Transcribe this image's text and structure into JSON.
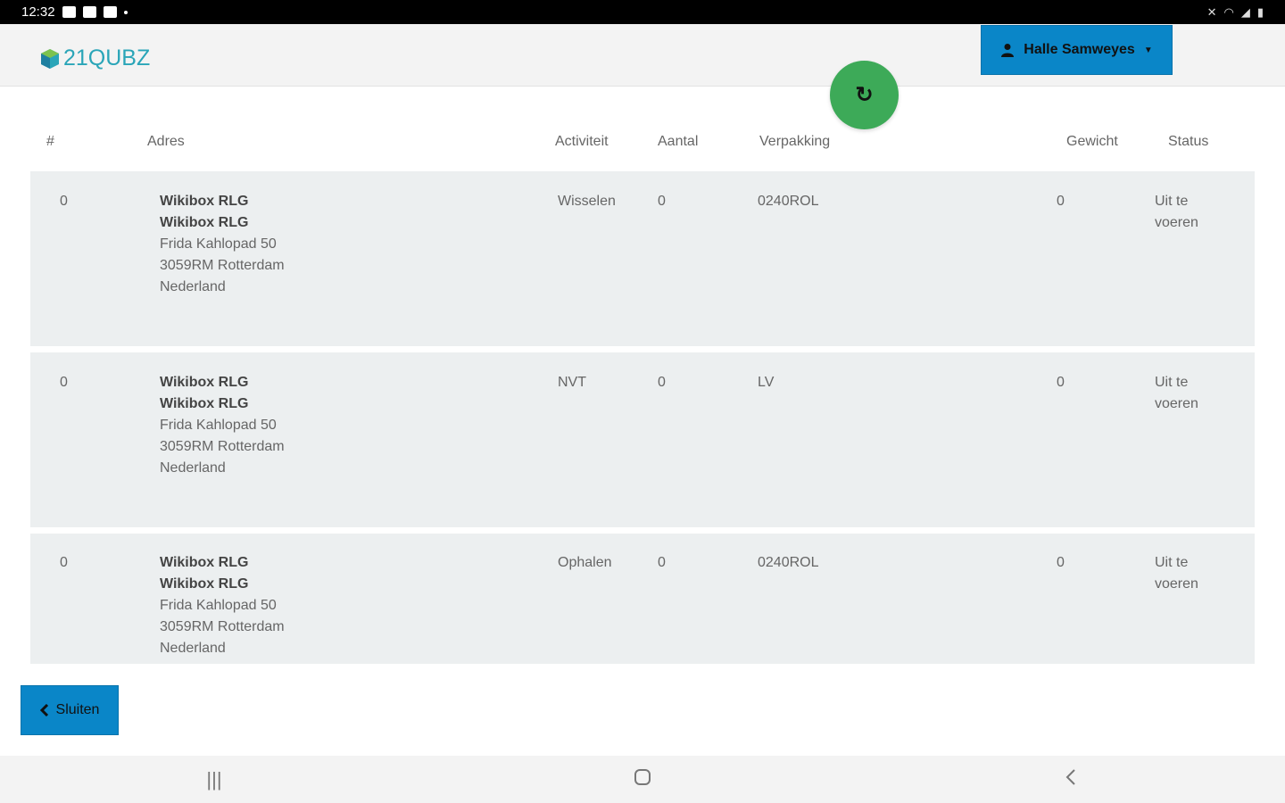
{
  "statusbar": {
    "time": "12:32"
  },
  "header": {
    "logo_text": "21QUBZ",
    "user_name": "Halle Samweyes"
  },
  "table": {
    "headers": {
      "num": "#",
      "address": "Adres",
      "activity": "Activiteit",
      "count": "Aantal",
      "packaging": "Verpakking",
      "weight": "Gewicht",
      "status": "Status"
    },
    "rows": [
      {
        "num": "0",
        "line1": "Wikibox RLG",
        "line2": "Wikibox RLG",
        "street": "Frida Kahlopad 50",
        "city": "3059RM Rotterdam",
        "country": "Nederland",
        "activity": "Wisselen",
        "count": "0",
        "packaging": "0240ROL",
        "weight": "0",
        "status_1": "Uit te",
        "status_2": "voeren"
      },
      {
        "num": "0",
        "line1": "Wikibox RLG",
        "line2": "Wikibox RLG",
        "street": "Frida Kahlopad 50",
        "city": "3059RM Rotterdam",
        "country": "Nederland",
        "activity": "NVT",
        "count": "0",
        "packaging": "LV",
        "weight": "0",
        "status_1": "Uit te",
        "status_2": "voeren"
      },
      {
        "num": "0",
        "line1": "Wikibox RLG",
        "line2": "Wikibox RLG",
        "street": "Frida Kahlopad 50",
        "city": "3059RM Rotterdam",
        "country": "Nederland",
        "activity": "Ophalen",
        "count": "0",
        "packaging": "0240ROL",
        "weight": "0",
        "status_1": "Uit te",
        "status_2": "voeren"
      }
    ]
  },
  "footer": {
    "close_label": "Sluiten"
  },
  "colors": {
    "primary_button": "#0a86c8",
    "refresh_fab": "#3daa58",
    "logo": "#2aa5b8",
    "row_bg": "#eceff0"
  },
  "icons": [
    "user-icon",
    "refresh-icon",
    "chevron-left-icon",
    "recents-icon",
    "home-icon",
    "back-icon"
  ]
}
